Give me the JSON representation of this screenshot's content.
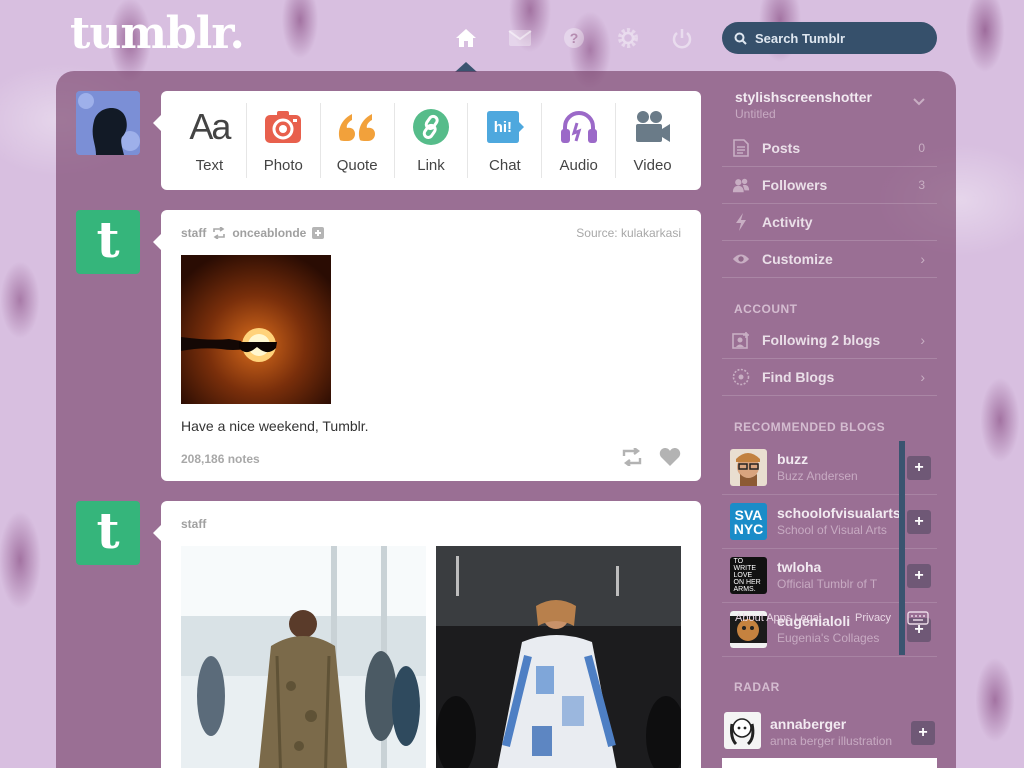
{
  "header": {
    "logo": "tumblr.",
    "search_placeholder": "Search Tumblr",
    "nav_icons": [
      "home-icon",
      "mail-icon",
      "help-icon",
      "gear-icon",
      "power-icon"
    ]
  },
  "composer": {
    "types": [
      {
        "label": "Text",
        "icon": "Aa"
      },
      {
        "label": "Photo",
        "icon": "camera-icon"
      },
      {
        "label": "Quote",
        "icon": "quote-icon"
      },
      {
        "label": "Link",
        "icon": "link-icon"
      },
      {
        "label": "Chat",
        "icon": "hi!"
      },
      {
        "label": "Audio",
        "icon": "headphones-icon"
      },
      {
        "label": "Video",
        "icon": "video-camera-icon"
      }
    ]
  },
  "posts": [
    {
      "author": "staff",
      "reblogged_from": "onceablonde",
      "source": "Source: kulakarkasi",
      "caption": "Have a nice weekend, Tumblr.",
      "notes": "208,186 notes",
      "avatar_letter": "t"
    },
    {
      "author": "staff",
      "avatar_letter": "t"
    }
  ],
  "sidebar": {
    "blog_name": "stylishscreenshotter",
    "blog_title": "Untitled",
    "items": [
      {
        "label": "Posts",
        "count": "0",
        "icon": "posts-icon"
      },
      {
        "label": "Followers",
        "count": "3",
        "icon": "followers-icon"
      },
      {
        "label": "Activity",
        "icon": "activity-icon"
      },
      {
        "label": "Customize",
        "icon": "eye-icon",
        "arrow": "›"
      }
    ],
    "account_title": "ACCOUNT",
    "account_items": [
      {
        "label": "Following 2 blogs",
        "icon": "following-icon",
        "arrow": "›"
      },
      {
        "label": "Find Blogs",
        "icon": "compass-icon",
        "arrow": "›"
      }
    ],
    "recommended_title": "RECOMMENDED BLOGS",
    "recommended": [
      {
        "name": "buzz",
        "subtitle": "Buzz Andersen",
        "avatar": "buzz-avatar"
      },
      {
        "name": "schoolofvisualarts",
        "subtitle": "School of Visual Arts",
        "avatar": "sva-avatar",
        "avatar_text": "SVA NYC"
      },
      {
        "name": "twloha",
        "subtitle": "Official Tumblr of T",
        "avatar": "twloha-avatar",
        "avatar_text": "TO WRITE LOVE ON HER ARMS."
      },
      {
        "name": "eugenialoli",
        "subtitle": "Eugenia's Collages",
        "avatar": "eugenia-avatar"
      }
    ],
    "overlay_left": "About   Apps   Legal",
    "overlay_right": "Privacy",
    "follow_label": "+",
    "radar_title": "RADAR",
    "radar": {
      "name": "annaberger",
      "subtitle": "anna berger illustration"
    }
  }
}
